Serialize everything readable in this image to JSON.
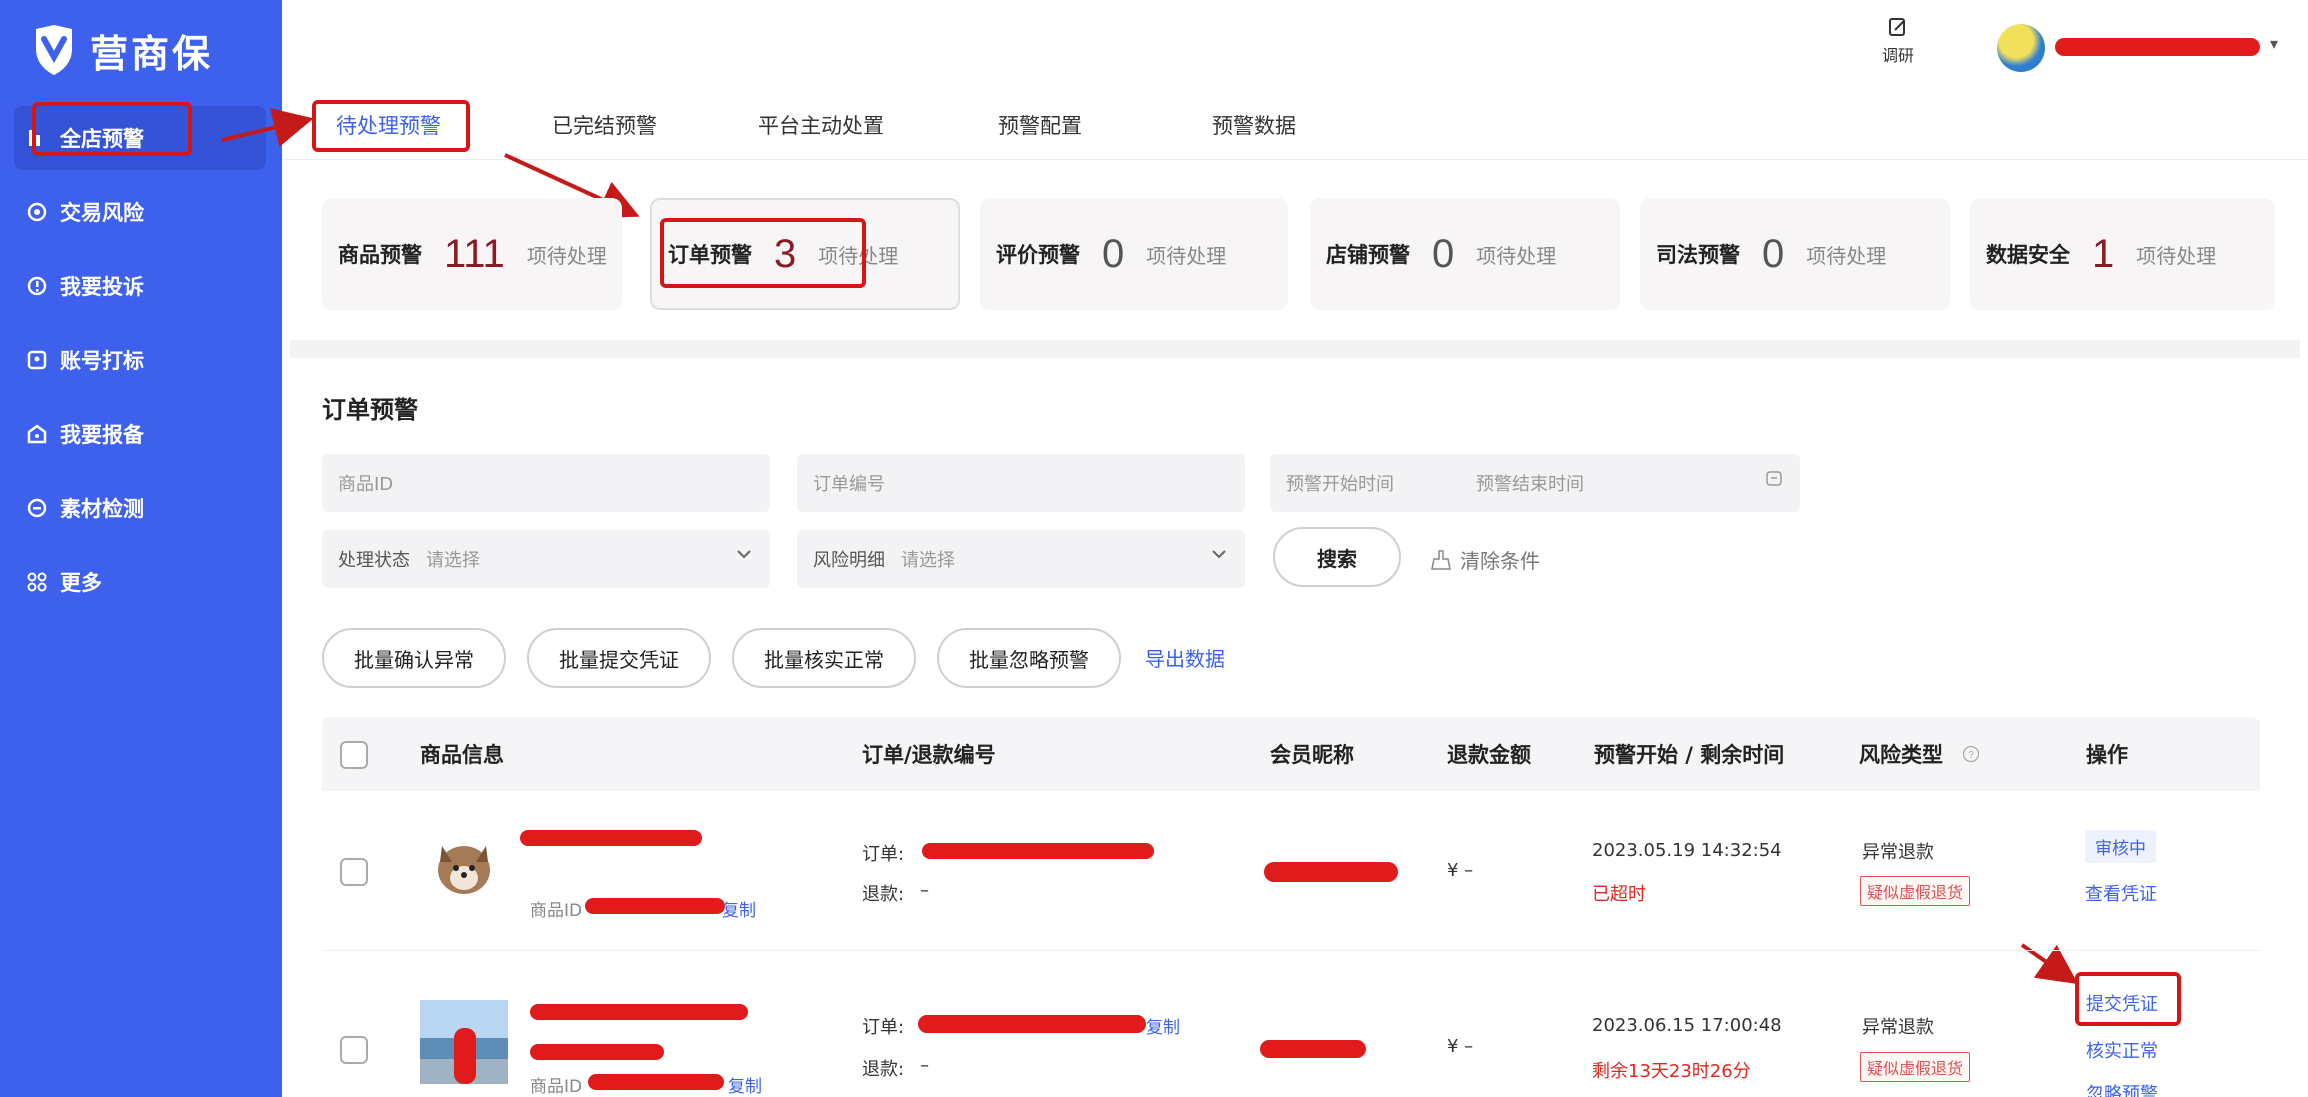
{
  "app": {
    "name": "营商保"
  },
  "sidebar": {
    "items": [
      {
        "label": "全店预警",
        "icon": "alert-icon"
      },
      {
        "label": "交易风险",
        "icon": "transaction-risk-icon"
      },
      {
        "label": "我要投诉",
        "icon": "complaint-icon"
      },
      {
        "label": "账号打标",
        "icon": "account-tag-icon"
      },
      {
        "label": "我要报备",
        "icon": "report-icon"
      },
      {
        "label": "素材检测",
        "icon": "material-check-icon"
      },
      {
        "label": "更多",
        "icon": "grid-more-icon"
      }
    ]
  },
  "topbar": {
    "tool_label": "调研"
  },
  "tabs": [
    {
      "label": "待处理预警"
    },
    {
      "label": "已完结预警"
    },
    {
      "label": "平台主动处置"
    },
    {
      "label": "预警配置"
    },
    {
      "label": "预警数据"
    }
  ],
  "cards": [
    {
      "label": "商品预警",
      "count": "111",
      "suffix": "项待处理"
    },
    {
      "label": "订单预警",
      "count": "3",
      "suffix": "项待处理"
    },
    {
      "label": "评价预警",
      "count": "0",
      "suffix": "项待处理"
    },
    {
      "label": "店铺预警",
      "count": "0",
      "suffix": "项待处理"
    },
    {
      "label": "司法预警",
      "count": "0",
      "suffix": "项待处理"
    },
    {
      "label": "数据安全",
      "count": "1",
      "suffix": "项待处理"
    }
  ],
  "section_title": "订单预警",
  "filters": {
    "product_id_placeholder": "商品ID",
    "order_no_placeholder": "订单编号",
    "start_time_placeholder": "预警开始时间",
    "end_time_placeholder": "预警结束时间",
    "status_label": "处理状态",
    "status_placeholder": "请选择",
    "risk_label": "风险明细",
    "risk_placeholder": "请选择",
    "search_label": "搜索",
    "clear_label": "清除条件"
  },
  "batch_actions": [
    "批量确认异常",
    "批量提交凭证",
    "批量核实正常",
    "批量忽略预警"
  ],
  "export_label": "导出数据",
  "table": {
    "headers": [
      "商品信息",
      "订单/退款编号",
      "会员昵称",
      "退款金额",
      "预警开始 / 剩余时间",
      "风险类型",
      "操作"
    ],
    "rows": [
      {
        "product_id_label": "商品ID",
        "copy_label": "复制",
        "order_label": "订单:",
        "refund_label": "退款:",
        "refund_value": "–",
        "amount": "¥ –",
        "start_time": "2023.05.19 14:32:54",
        "remaining": "已超时",
        "risk_type": "异常退款",
        "risk_tag": "疑似虚假退货",
        "status_tag": "审核中",
        "action_1": "查看凭证"
      },
      {
        "product_id_label": "商品ID",
        "copy_label": "复制",
        "order_copy_label": "复制",
        "order_label": "订单:",
        "refund_label": "退款:",
        "refund_value": "–",
        "amount": "¥ –",
        "start_time": "2023.06.15 17:00:48",
        "remaining": "剩余13天23时26分",
        "risk_type": "异常退款",
        "risk_tag": "疑似虚假退货",
        "action_1": "提交凭证",
        "action_2": "核实正常",
        "action_3": "忽略预警"
      }
    ]
  },
  "colors": {
    "sidebar": "#3d61ec",
    "accent": "#3d61ec",
    "annotation": "#d51616",
    "warning_text": "#e0281f"
  }
}
